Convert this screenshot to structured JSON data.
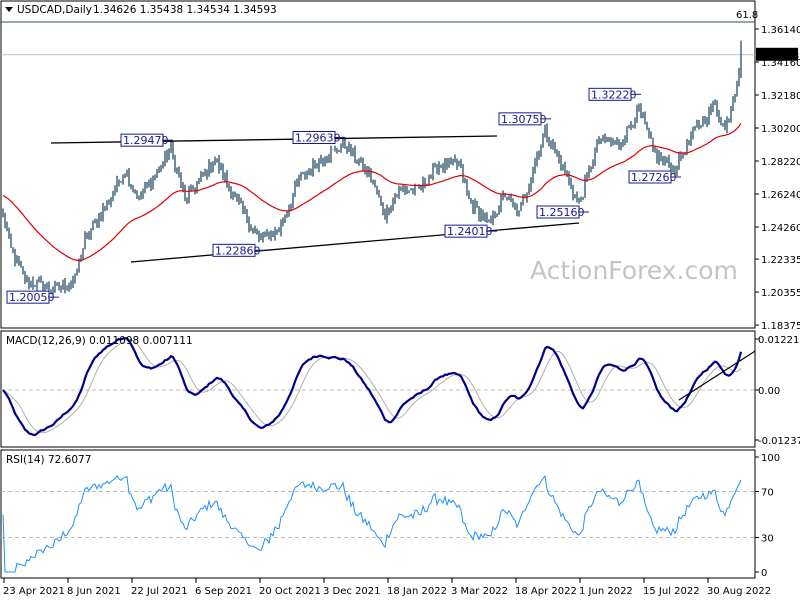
{
  "header": {
    "symbol": "USDCAD,Daily",
    "ohlc": "1.34626 1.35438 1.34534 1.34593"
  },
  "watermark": "ActionForex.com",
  "chart_data": {
    "type": "ohlc",
    "title": "USDCAD,Daily",
    "bars_count": 370,
    "x_ticks": [
      {
        "bar": 0,
        "label": "23 Apr 2021"
      },
      {
        "bar": 32,
        "label": "8 Jun 2021"
      },
      {
        "bar": 64,
        "label": "22 Jul 2021"
      },
      {
        "bar": 96,
        "label": "6 Sep 2021"
      },
      {
        "bar": 128,
        "label": "20 Oct 2021"
      },
      {
        "bar": 160,
        "label": "3 Dec 2021"
      },
      {
        "bar": 192,
        "label": "18 Jan 2022"
      },
      {
        "bar": 224,
        "label": "3 Mar 2022"
      },
      {
        "bar": 256,
        "label": "18 Apr 2022"
      },
      {
        "bar": 288,
        "label": "1 Jun 2022"
      },
      {
        "bar": 320,
        "label": "15 Jul 2022"
      },
      {
        "bar": 352,
        "label": "30 Aug 2022"
      }
    ],
    "price_axis": {
      "ylim": [
        1.18375,
        1.3614
      ],
      "ticks": [
        "1.36140",
        "1.34160",
        "1.32180",
        "1.30200",
        "1.28220",
        "1.26240",
        "1.24260",
        "1.22335",
        "1.20355",
        "1.18375"
      ],
      "current_price": "1.34593"
    },
    "close_waypoints": [
      [
        0,
        1.2498
      ],
      [
        4,
        1.2288
      ],
      [
        11,
        1.2108
      ],
      [
        26,
        1.2048
      ],
      [
        36,
        1.211
      ],
      [
        41,
        1.235
      ],
      [
        53,
        1.259
      ],
      [
        61,
        1.277
      ],
      [
        68,
        1.259
      ],
      [
        84,
        1.289
      ],
      [
        91,
        1.259
      ],
      [
        106,
        1.283
      ],
      [
        118,
        1.256
      ],
      [
        128,
        1.235
      ],
      [
        138,
        1.241
      ],
      [
        148,
        1.271
      ],
      [
        158,
        1.283
      ],
      [
        171,
        1.292
      ],
      [
        183,
        1.274
      ],
      [
        191,
        1.25
      ],
      [
        198,
        1.265
      ],
      [
        208,
        1.265
      ],
      [
        218,
        1.28
      ],
      [
        228,
        1.28
      ],
      [
        233,
        1.259
      ],
      [
        243,
        1.244
      ],
      [
        251,
        1.262
      ],
      [
        258,
        1.25
      ],
      [
        271,
        1.301
      ],
      [
        278,
        1.283
      ],
      [
        288,
        1.256
      ],
      [
        298,
        1.295
      ],
      [
        308,
        1.292
      ],
      [
        318,
        1.313
      ],
      [
        326,
        1.286
      ],
      [
        336,
        1.277
      ],
      [
        346,
        1.301
      ],
      [
        356,
        1.316
      ],
      [
        361,
        1.301
      ],
      [
        366,
        1.325
      ],
      [
        369,
        1.3459
      ]
    ],
    "moving_average": {
      "type": "EMA",
      "period": 50,
      "color": "#e00000"
    },
    "fib_level": {
      "label": "61.8",
      "price": 1.3656
    },
    "annotations": [
      {
        "text": "1.20050",
        "bar": 28,
        "price": 1.2005
      },
      {
        "text": "1.29470",
        "bar": 85,
        "price": 1.2947
      },
      {
        "text": "1.22860",
        "bar": 131,
        "price": 1.2286
      },
      {
        "text": "1.29630",
        "bar": 171,
        "price": 1.2963
      },
      {
        "text": "1.24010",
        "bar": 247,
        "price": 1.2401
      },
      {
        "text": "1.30750",
        "bar": 274,
        "price": 1.3075
      },
      {
        "text": "1.25160",
        "bar": 293,
        "price": 1.2516
      },
      {
        "text": "1.32220",
        "bar": 319,
        "price": 1.3222
      },
      {
        "text": "1.27260",
        "bar": 339,
        "price": 1.2726
      }
    ],
    "trendlines": [
      {
        "name": "upper-trendline",
        "from": [
          24,
          1.293
        ],
        "to": [
          247,
          1.2972
        ]
      },
      {
        "name": "lower-trendline",
        "from": [
          64,
          1.2216
        ],
        "to": [
          288,
          1.245
        ]
      }
    ],
    "macd": {
      "label": "MACD(12,26,9) 0.011098 0.007111",
      "ticks": [
        "0.012216",
        "0.00",
        "-0.012375"
      ],
      "ylim": [
        -0.012375,
        0.012216
      ],
      "trendline": {
        "from": [
          338,
          -0.0024
        ],
        "to": [
          376,
          0.0093
        ]
      },
      "main_color": "#00008b",
      "signal_color": "#b0b0b0"
    },
    "rsi": {
      "label": "RSI(14) 72.6077",
      "ticks": [
        "100",
        "70",
        "30",
        "0"
      ],
      "levels": [
        70,
        30
      ],
      "color": "#1e90ff"
    },
    "colors": {
      "bars": "#133e58",
      "label_border": "#1a1a8c"
    }
  }
}
